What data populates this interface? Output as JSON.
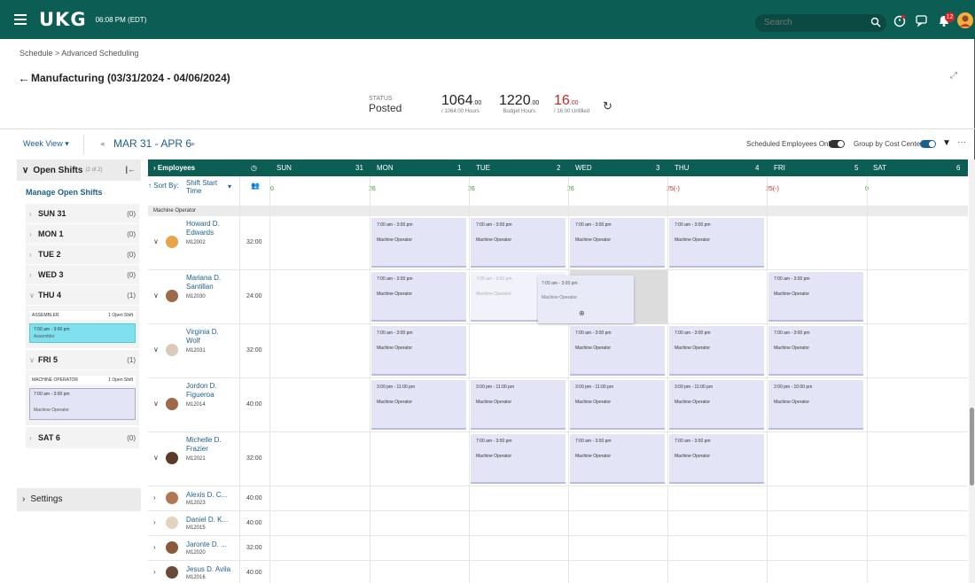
{
  "topbar": {
    "logo": "UKG",
    "time": "06:08 PM (EDT)",
    "search_placeholder": "Search",
    "notification_count": "12"
  },
  "breadcrumb": "Schedule > Advanced Scheduling",
  "page_title": "Manufacturing (03/31/2024 - 04/06/2024)",
  "stats": {
    "status_label": "STATUS",
    "status_value": "Posted",
    "hours_value": "1064",
    "hours_dec": ".00",
    "hours_label": "/ 1064:00 Hours",
    "budget_value": "1220",
    "budget_dec": ".00",
    "budget_label": "Budget Hours",
    "unfilled_value": "16",
    "unfilled_dec": ".00",
    "unfilled_label": "/ 16:00 Unfilled"
  },
  "toolbar": {
    "week_view": "Week View ▾",
    "range": "MAR 31 - APR 6",
    "scheduled_only": "Scheduled Employees Only",
    "group_by_cost": "Group by Cost Center"
  },
  "open_shifts": {
    "title": "Open Shifts",
    "count_label": "(2 of 2)",
    "manage": "Manage Open Shifts",
    "days": [
      {
        "label": "SUN 31",
        "count": "(0)"
      },
      {
        "label": "MON 1",
        "count": "(0)"
      },
      {
        "label": "TUE 2",
        "count": "(0)"
      },
      {
        "label": "WED 3",
        "count": "(0)"
      },
      {
        "label": "THU 4",
        "count": "(1)"
      },
      {
        "label": "FRI 5",
        "count": "(1)"
      },
      {
        "label": "SAT 6",
        "count": "(0)"
      }
    ],
    "thu_group": {
      "name": "ASSEMBLER",
      "open": "1 Open Shift",
      "time": "7:00 am - 3:00 pm",
      "role": "Assembler"
    },
    "fri_group": {
      "name": "MACHINE OPERATOR",
      "open": "1 Open Shift",
      "time": "7:00 am - 3:00 pm",
      "role": "Machine Operator"
    },
    "settings": "Settings"
  },
  "grid": {
    "employees_label": "Employees",
    "sort_label": "Sort By:",
    "sort_value": "Shift Start Time",
    "total_count": "0",
    "days": [
      {
        "name": "SUN",
        "num": "31",
        "count": "0"
      },
      {
        "name": "MON",
        "num": "1",
        "count": "26"
      },
      {
        "name": "TUE",
        "num": "2",
        "count": "26"
      },
      {
        "name": "WED",
        "num": "3",
        "count": "26"
      },
      {
        "name": "THU",
        "num": "4",
        "count": "25(-)"
      },
      {
        "name": "FRI",
        "num": "5",
        "count": "25(-)"
      },
      {
        "name": "SAT",
        "num": "6",
        "count": "0"
      }
    ],
    "group_name": "Machine Operator",
    "employees": [
      {
        "first": "Howard D.",
        "last": "Edwards",
        "id": "M12002",
        "hours": "32:00"
      },
      {
        "first": "Mariana D.",
        "last": "Santillan",
        "id": "M12030",
        "hours": "24:00"
      },
      {
        "first": "Virginia D.",
        "last": "Wolf",
        "id": "M12031",
        "hours": "32:00"
      },
      {
        "first": "Jordon D.",
        "last": "Figueroa",
        "id": "M12014",
        "hours": "40:00"
      },
      {
        "first": "Michelle D.",
        "last": "Frazier",
        "id": "M12021",
        "hours": "32:00"
      },
      {
        "first": "Alexis D. C...",
        "last": "",
        "id": "M12023",
        "hours": "40:00"
      },
      {
        "first": "Daniel D. K...",
        "last": "",
        "id": "M12015",
        "hours": "40:00"
      },
      {
        "first": "Jaronte D. ...",
        "last": "",
        "id": "M12020",
        "hours": "32:00"
      },
      {
        "first": "Jesus D. Avila",
        "last": "",
        "id": "M12016",
        "hours": "40:00"
      }
    ],
    "shift_day": "7:00 am - 3:00 pm",
    "shift_evening": "3:00 pm - 11:00 pm",
    "shift_late": "2:00 pm - 10:00 pm",
    "shift_role": "Machine Operator"
  },
  "colors": {
    "brand": "#0c5e54",
    "link": "#1d5f8f",
    "shift": "#e3e4f6",
    "green": "#3a9a2a",
    "red": "#c62828"
  }
}
